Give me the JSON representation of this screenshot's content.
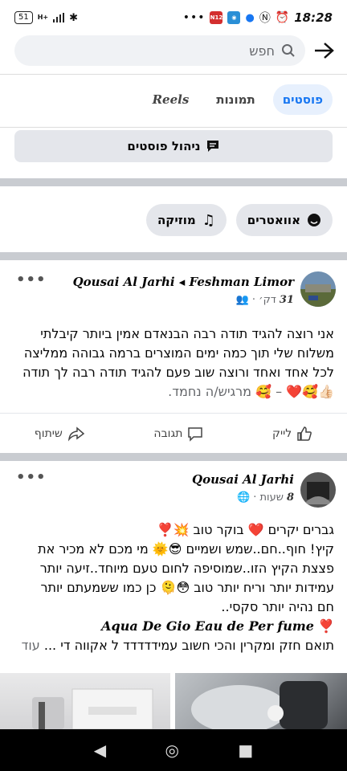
{
  "status_bar": {
    "battery": "51",
    "network": "H+",
    "time": "18:28",
    "badge_1": "N12"
  },
  "search": {
    "placeholder": "חפש"
  },
  "tabs": [
    {
      "label": "פוסטים",
      "active": true
    },
    {
      "label": "תמונות",
      "active": false
    },
    {
      "label": "Reels",
      "active": false
    }
  ],
  "manage_posts_label": "ניהול פוסטים",
  "chips": {
    "avatars": "אוואטרים",
    "music": "מוזיקה"
  },
  "post1": {
    "author": "Qousai Al Jarhi ◂ Feshman Limor",
    "time_num": "31",
    "time_unit": "דק׳ ·",
    "text": "אני רוצה להגיד תודה רבה הבנאדם אמין ביותר קיבלתי משלוח שלי תוך כמה ימים המוצרים ברמה גבוהה ממליצה לכל אחד ואחד ורוצה שוב פעם להגיד תודה רבה לך תודה👍🏻🥰❤️",
    "reactions": "– 🥰 מרגיש/ה נחמד.",
    "actions": {
      "like": "לייק",
      "comment": "תגובה",
      "share": "שיתוף"
    }
  },
  "post2": {
    "author": "Qousai Al Jarhi",
    "time_num": "8",
    "time_unit": "שעות ·",
    "lines": [
      "גברים יקרים ❤️ בוקר טוב 💥❣️",
      "קיץ! חוף..חם..שמש ושמיים 😎🌞 מי מכם לא מכיר את",
      "פצצת הקיץ הזו..שמוסיפה לחום טעם מיוחד..זיעה יותר",
      "עמידות יותר וריח יותר טוב 😳🫠 כן כמו ששמעתם יותר",
      "חם נהיה יותר סקסי.."
    ],
    "perfume": "Aqua De Gio Eau de Per fume",
    "last_line": "תואם חזק ומקרין והכי חשוב עמידדדדד ל אקווה די ...",
    "more": "עוד"
  },
  "colors": {
    "accent": "#1877f2",
    "tab_active_bg": "#e7f0fd",
    "chip_bg": "#e4e6eb",
    "separator": "#c9ccd1"
  }
}
